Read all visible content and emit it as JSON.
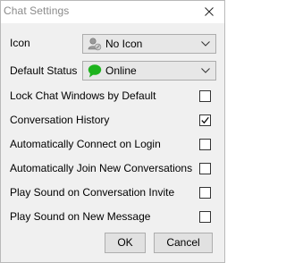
{
  "window": {
    "title": "Chat Settings"
  },
  "fields": {
    "icon": {
      "label": "Icon",
      "value": "No Icon",
      "icon": "person-silhouette-icon"
    },
    "status": {
      "label": "Default Status",
      "value": "Online",
      "icon": "green-speech-bubble-icon",
      "status_color": "#1db31d"
    }
  },
  "options": [
    {
      "label": "Lock Chat Windows by Default",
      "checked": false
    },
    {
      "label": "Conversation History",
      "checked": true
    },
    {
      "label": "Automatically Connect on Login",
      "checked": false
    },
    {
      "label": "Automatically Join New Conversations",
      "checked": false
    },
    {
      "label": "Play Sound on Conversation Invite",
      "checked": false
    },
    {
      "label": "Play Sound on New Message",
      "checked": false
    }
  ],
  "buttons": {
    "ok": "OK",
    "cancel": "Cancel"
  }
}
